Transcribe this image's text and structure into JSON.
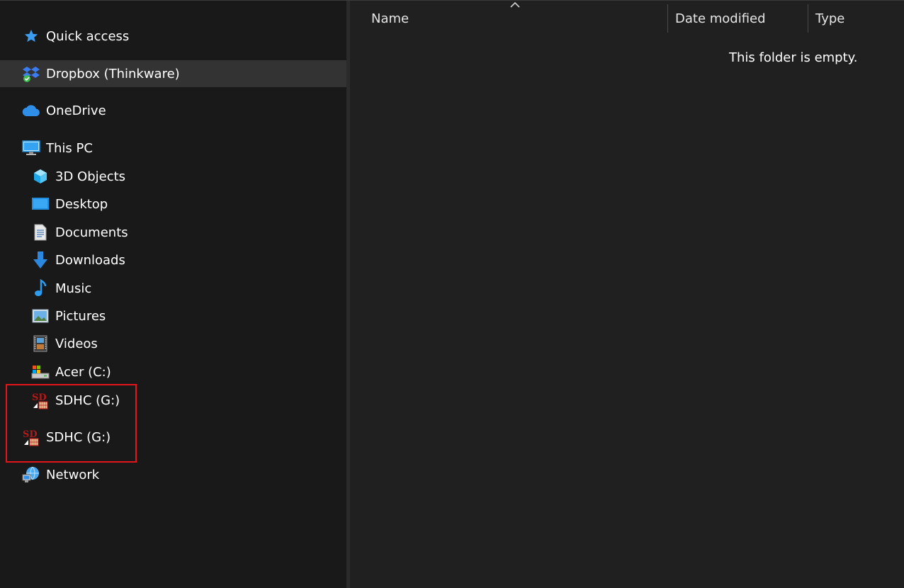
{
  "nav": {
    "quick_access": "Quick access",
    "dropbox": "Dropbox (Thinkware)",
    "onedrive": "OneDrive",
    "this_pc": "This PC",
    "objects_3d": "3D Objects",
    "desktop": "Desktop",
    "documents": "Documents",
    "downloads": "Downloads",
    "music": "Music",
    "pictures": "Pictures",
    "videos": "Videos",
    "drive_c": "Acer (C:)",
    "drive_g_child": "SDHC (G:)",
    "drive_g_root": "SDHC (G:)",
    "network": "Network"
  },
  "columns": {
    "name": "Name",
    "date_modified": "Date modified",
    "type": "Type"
  },
  "empty_message": "This folder is empty.",
  "icons": {
    "quick_access": "star-icon",
    "dropbox": "dropbox-icon",
    "onedrive": "cloud-icon",
    "this_pc": "computer-icon",
    "objects_3d": "cube-icon",
    "desktop": "desktop-icon",
    "documents": "document-icon",
    "downloads": "download-arrow-icon",
    "music": "music-note-icon",
    "pictures": "picture-icon",
    "videos": "film-icon",
    "drive_c": "drive-icon",
    "sd_card": "sd-card-icon",
    "network": "network-icon"
  },
  "colors": {
    "accent_blue": "#3b9cf0",
    "selection": "#333333",
    "highlight_border": "#e3151b"
  }
}
